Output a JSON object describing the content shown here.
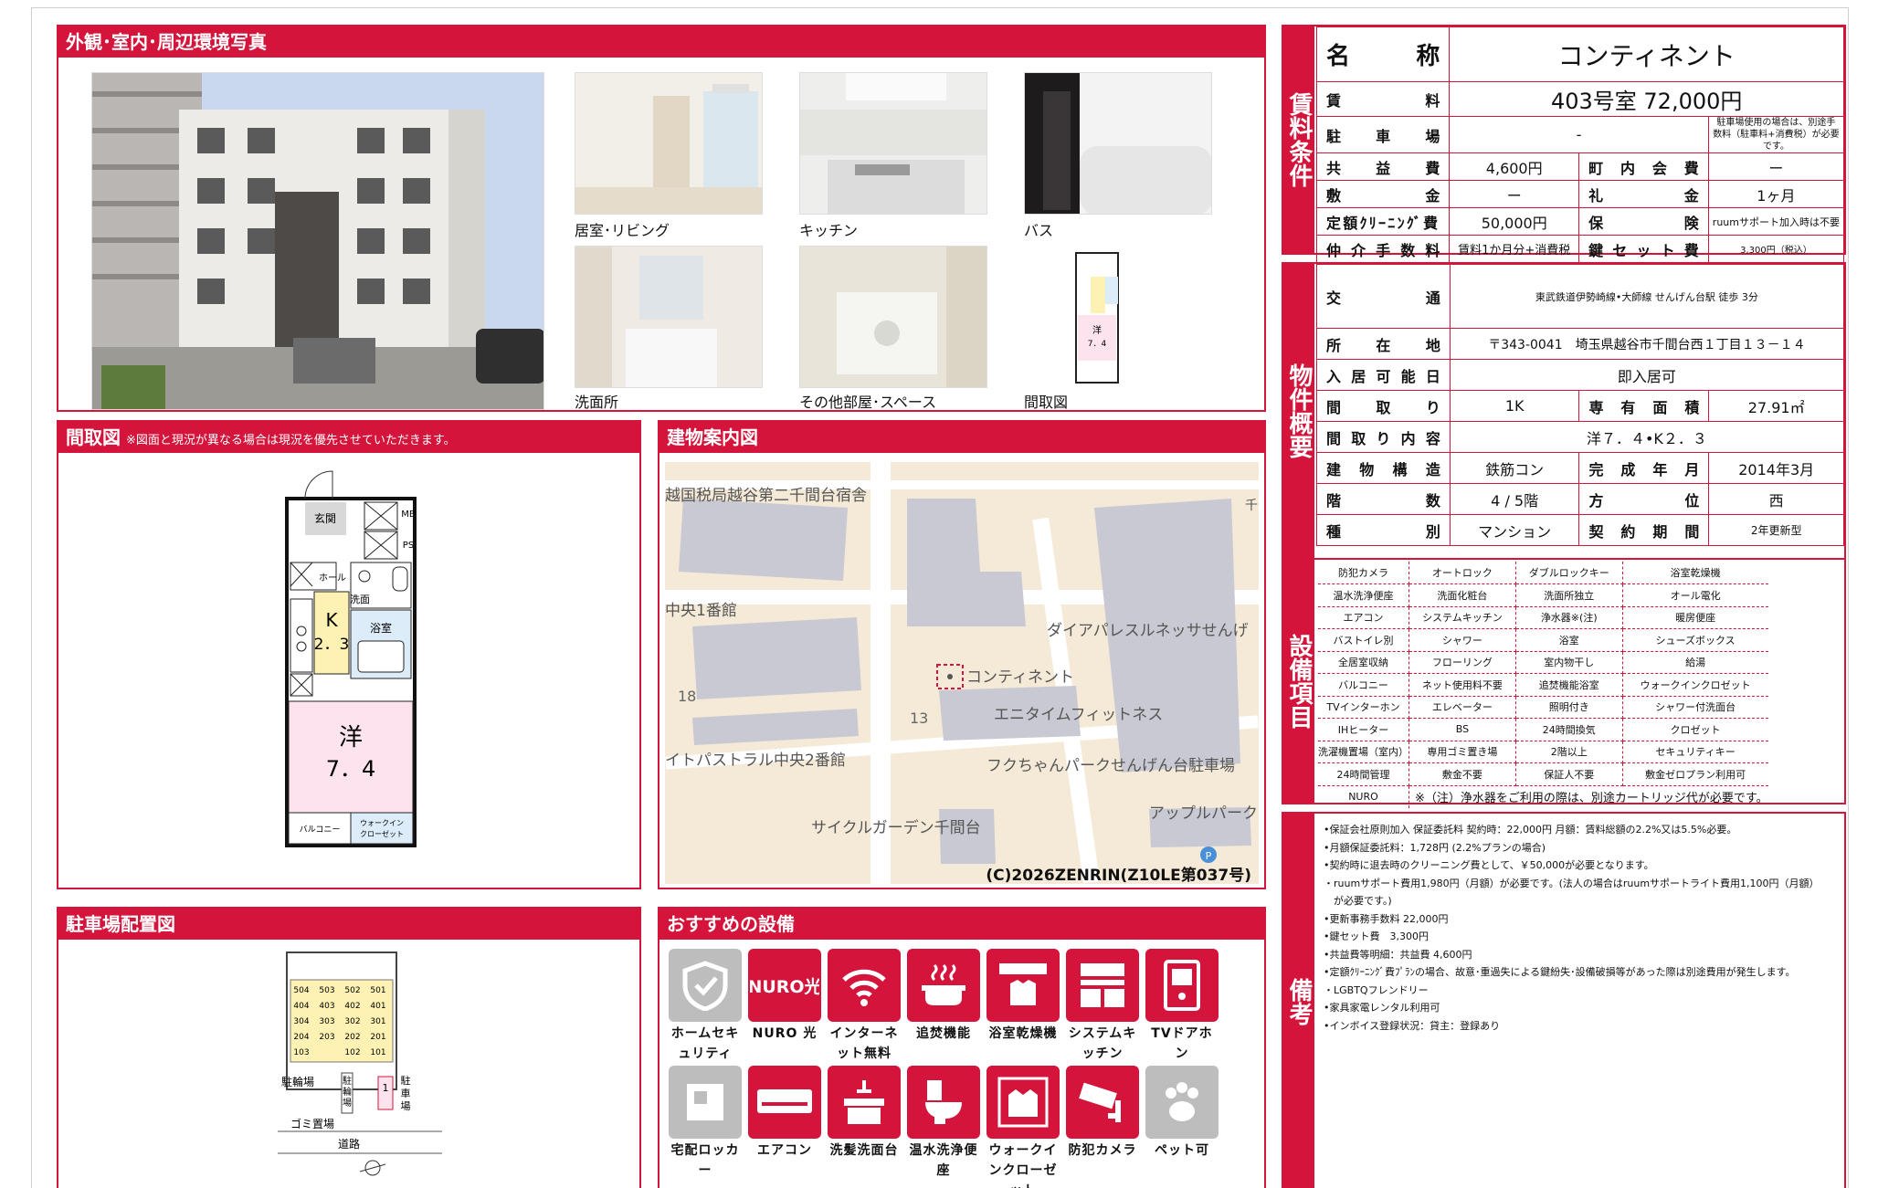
{
  "sections": {
    "photos_title": "外観･室内･周辺環境写真",
    "floorplan_title": "間取図",
    "floorplan_note": "※図面と現況が異なる場合は現況を優先させていただきます。",
    "map_title": "建物案内図",
    "parking_title": "駐車場配置図",
    "recommended_title": "おすすめの設備"
  },
  "photo_captions": [
    "居室･リビング",
    "キッチン",
    "バス",
    "洗面所",
    "その他部屋･スペース",
    "間取図"
  ],
  "floorplan_labels": {
    "mb": "MB",
    "ps": "PS",
    "genkan": "玄関",
    "hall": "ホール",
    "senmen": "洗面",
    "yokushitsu": "浴室",
    "k": "K",
    "k_size": "2．3",
    "western": "洋",
    "western_size": "7．4",
    "balcony": "バルコニー",
    "walkin": "ウォークイン\nクローゼット",
    "thumb_western": "洋",
    "thumb_size": "7．4"
  },
  "map_labels": {
    "l1": "越国税局越谷第二千間台宿舎",
    "l2": "中央1番館",
    "l3": "ダイアパレスルネッサせんげ",
    "l4": "コンティネント",
    "l5": "エニタイムフィットネス",
    "l6": "18",
    "l7": "13",
    "l8": "イトパストラル中央2番館",
    "l9": "フクちゃんパークせんげん台駐車場",
    "l10": "サイクルガーデン千間台",
    "l11": "アップルパーク",
    "l12": "千",
    "credit": "(C)2026ZENRIN(Z10LE第037号)"
  },
  "parking_labels": {
    "units": [
      [
        "504",
        "503",
        "502",
        "501"
      ],
      [
        "404",
        "403",
        "402",
        "401"
      ],
      [
        "304",
        "303",
        "302",
        "301"
      ],
      [
        "204",
        "203",
        "202",
        "201"
      ],
      [
        "103",
        "",
        "102",
        "101"
      ]
    ],
    "churinjo": "駐輪場",
    "churinjo2": "駐輪場",
    "slot": "1",
    "chushajo": "駐車場",
    "gomi": "ゴミ置場",
    "road": "道路"
  },
  "conditions": {
    "label": "賃料条件",
    "name_label": "名　　称",
    "name": "コンティネント",
    "rent_label": "賃　　料",
    "rent": "403号室 72,000円",
    "parking_label": "駐　車　場",
    "parking": "-",
    "parking_note": "駐車場使用の場合は、別途手数料（駐車料+消費税）が必要です。",
    "common_label": "共　益　費",
    "common": "4,600円",
    "chonaikai_label": "町　内　会　費",
    "chonaikai": "ー",
    "shikikin_label": "敷　　金",
    "shikikin": "ー",
    "reikin_label": "礼　　金",
    "reikin": "1ヶ月",
    "cleaning_label": "定額ｸﾘｰﾆﾝｸﾞ費",
    "cleaning": "50,000円",
    "insurance_label": "保　　険",
    "insurance": "ruumサポート加入時は不要",
    "brokerage_label": "仲 介 手 数 料",
    "brokerage": "賃料1か月分+消費税",
    "keyset_label": "鍵 セ ッ ト 費",
    "keyset": "3,300円（税込）"
  },
  "overview": {
    "label": "物件概要",
    "transport_label": "交　　通",
    "transport": "東武鉄道伊勢崎線•大師線 せんげん台駅 徒歩 3分",
    "address_label": "所　在　地",
    "address": "〒343-0041　埼玉県越谷市千間台西１丁目１３－１４",
    "movein_label": "入 居 可 能 日",
    "movein": "即入居可",
    "layout_label": "間　取　り",
    "layout": "1K",
    "area_label": "専　有　面　積",
    "area": "27.91㎡",
    "layout_detail_label": "間 取 り 内 容",
    "layout_detail": "洋７．４•K２．３",
    "structure_label": "建　物　構　造",
    "structure": "鉄筋コン",
    "built_label": "完　成　年　月",
    "built": "2014年3月",
    "floor_label": "階　　数",
    "floor": "4 / 5階",
    "direction_label": "方　　位",
    "direction": "西",
    "type_label": "種　　別",
    "type": "マンション",
    "contract_label": "契　約　期　間",
    "contract": "2年更新型"
  },
  "equipment": {
    "label": "設備項目",
    "rows": [
      [
        "防犯カメラ",
        "オートロック",
        "ダブルロックキー",
        "浴室乾燥機"
      ],
      [
        "温水洗浄便座",
        "洗面化粧台",
        "洗面所独立",
        "オール電化"
      ],
      [
        "エアコン",
        "システムキッチン",
        "浄水器※(注)",
        "暖房便座"
      ],
      [
        "バストイレ別",
        "シャワー",
        "浴室",
        "シューズボックス"
      ],
      [
        "全居室収納",
        "フローリング",
        "室内物干し",
        "給湯"
      ],
      [
        "バルコニー",
        "ネット使用料不要",
        "追焚機能浴室",
        "ウォークインクロゼット"
      ],
      [
        "TVインターホン",
        "エレベーター",
        "照明付き",
        "シャワー付洗面台"
      ],
      [
        "IHヒーター",
        "BS",
        "24時間換気",
        "クロゼット"
      ],
      [
        "洗濯機置場（室内）",
        "専用ゴミ置き場",
        "2階以上",
        "セキュリティキー"
      ],
      [
        "24時間管理",
        "敷金不要",
        "保証人不要",
        "敷金ゼロプラン利用可"
      ]
    ],
    "last_item": "NURO",
    "note": "※（注）浄水器をご利用の際は、別途カートリッジ代が必要です。"
  },
  "remarks": {
    "label": "備考",
    "lines": [
      "•保証会社原則加入 保証委託料 契約時：22,000円 月額：賃料総額の2.2%又は5.5%必要。",
      "•月額保証委託料：1,728円 (2.2%プランの場合)",
      "•契約時に退去時のクリーニング費として、￥50,000が必要となります。",
      "・ruumサポート費用1,980円（月額）が必要です。(法人の場合はruumサポートライト費用1,100円（月額）\n　が必要です。)",
      "•更新事務手数料 22,000円",
      "•鍵セット費　3,300円",
      "•共益費等明細：共益費 4,600円",
      "•定額ｸﾘｰﾆﾝｸﾞ費ﾌﾟﾗﾝの場合、故意･重過失による鍵紛失･設備破損等があった際は別途費用が発生します。",
      "・LGBTQフレンドリー",
      "•家具家電レンタル利用可",
      "•インボイス登録状況：貸主：登録あり"
    ]
  },
  "recommended": [
    {
      "label": "ホームセキュリティ",
      "icon": "shield-icon",
      "gray": true
    },
    {
      "label": "NURO 光",
      "icon": "nuro-logo-icon",
      "gray": false,
      "logo": "NURO光"
    },
    {
      "label": "インターネット無料",
      "icon": "wifi-icon",
      "gray": false
    },
    {
      "label": "追焚機能",
      "icon": "bathtub-icon",
      "gray": false
    },
    {
      "label": "浴室乾燥機",
      "icon": "bath-dryer-icon",
      "gray": false
    },
    {
      "label": "システムキッチン",
      "icon": "kitchen-icon",
      "gray": false
    },
    {
      "label": "TVドアホン",
      "icon": "tv-doorphone-icon",
      "gray": false
    },
    {
      "label": "宅配ロッカー",
      "icon": "delivery-locker-icon",
      "gray": true
    },
    {
      "label": "エアコン",
      "icon": "air-conditioner-icon",
      "gray": false
    },
    {
      "label": "洗髪洗面台",
      "icon": "washbasin-icon",
      "gray": false
    },
    {
      "label": "温水洗浄便座",
      "icon": "toilet-icon",
      "gray": false
    },
    {
      "label": "ウォークインクローゼット",
      "icon": "walk-in-closet-icon",
      "gray": false
    },
    {
      "label": "防犯カメラ",
      "icon": "security-camera-icon",
      "gray": false
    },
    {
      "label": "ペット可",
      "icon": "paw-icon",
      "gray": true
    }
  ],
  "colors": {
    "accent": "#d4143b",
    "pink": "#fde3ee",
    "yellow": "#fdf2b3",
    "blue": "#dcecf8",
    "map_bg": "#f5ead7",
    "map_building": "#c9c9d3"
  }
}
